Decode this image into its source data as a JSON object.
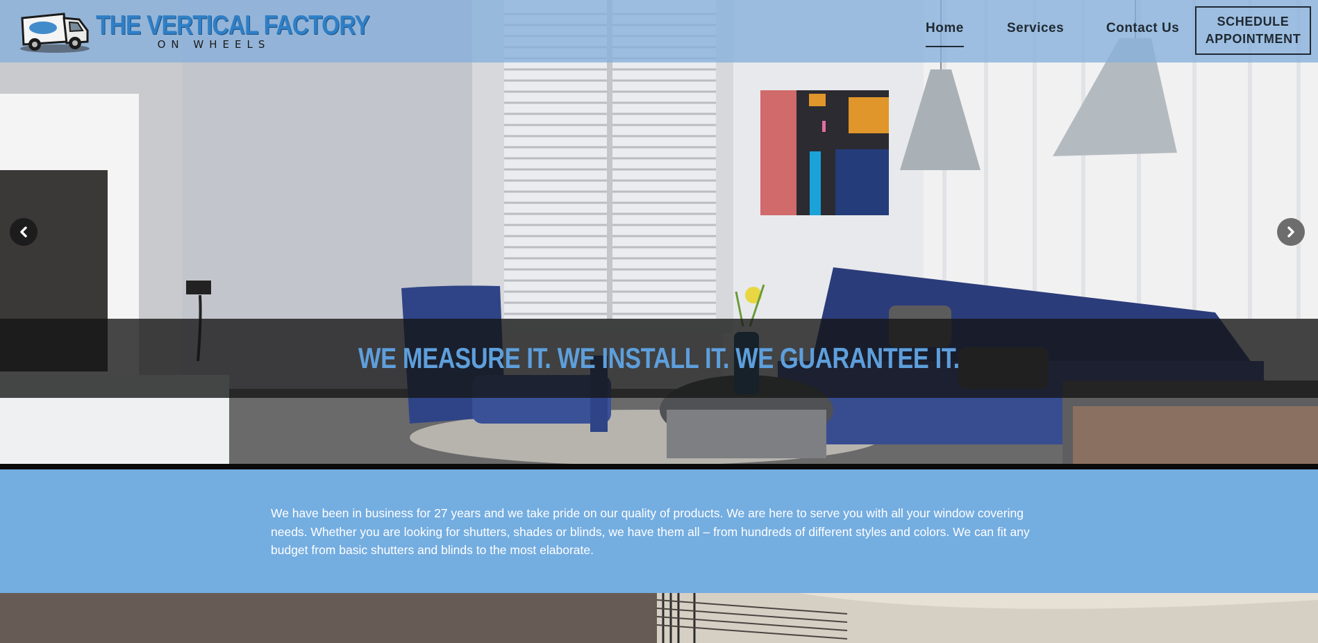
{
  "brand": {
    "title": "THE VERTICAL FACTORY",
    "subtitle": "ON WHEELS",
    "accent_color": "#2f7fc6"
  },
  "nav": {
    "items": [
      {
        "label": "Home",
        "active": true
      },
      {
        "label": "Services",
        "active": false
      },
      {
        "label": "Contact Us",
        "active": false
      }
    ],
    "cta_label": "SCHEDULE\nAPPOINTMENT"
  },
  "hero": {
    "caption": "WE MEASURE IT. WE INSTALL IT. WE GUARANTEE IT.",
    "prev_icon": "chevron-left-icon",
    "next_icon": "chevron-right-icon"
  },
  "about": {
    "text": "We have been in business for 27 years and we take pride on our quality of products. We are here to serve you with all your window covering needs. Whether you are looking for shutters, shades or blinds, we have them all – from hundreds of different styles and colors. We can fit any budget from basic shutters and blinds to the most elaborate.",
    "background_color": "#74ade0"
  }
}
